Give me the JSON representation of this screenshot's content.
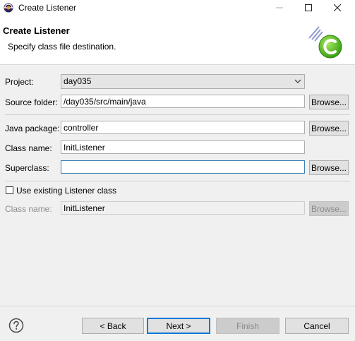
{
  "window": {
    "title": "Create Listener",
    "controls": {
      "minimize": "minimize-icon",
      "maximize": "maximize-icon",
      "close": "close-icon"
    }
  },
  "banner": {
    "title": "Create Listener",
    "description": "Specify class file destination.",
    "graphic": "new-class-wizard-icon"
  },
  "form": {
    "project": {
      "label": "Project:",
      "value": "day035"
    },
    "source_folder": {
      "label": "Source folder:",
      "value": "/day035/src/main/java",
      "browse": "Browse..."
    },
    "java_package": {
      "label": "Java package:",
      "value": "controller",
      "browse": "Browse..."
    },
    "class_name": {
      "label": "Class name:",
      "value": "InitListener"
    },
    "superclass": {
      "label": "Superclass:",
      "value": "",
      "browse": "Browse..."
    },
    "use_existing": {
      "label": "Use existing Listener class",
      "checked": false
    },
    "existing_class_name": {
      "label": "Class name:",
      "value": "InitListener",
      "browse": "Browse..."
    }
  },
  "footer": {
    "help_icon": "help-icon",
    "back": "< Back",
    "next": "Next >",
    "finish": "Finish",
    "cancel": "Cancel"
  },
  "colors": {
    "accent": "#0078d7",
    "focus_border": "#3c7fb1"
  }
}
